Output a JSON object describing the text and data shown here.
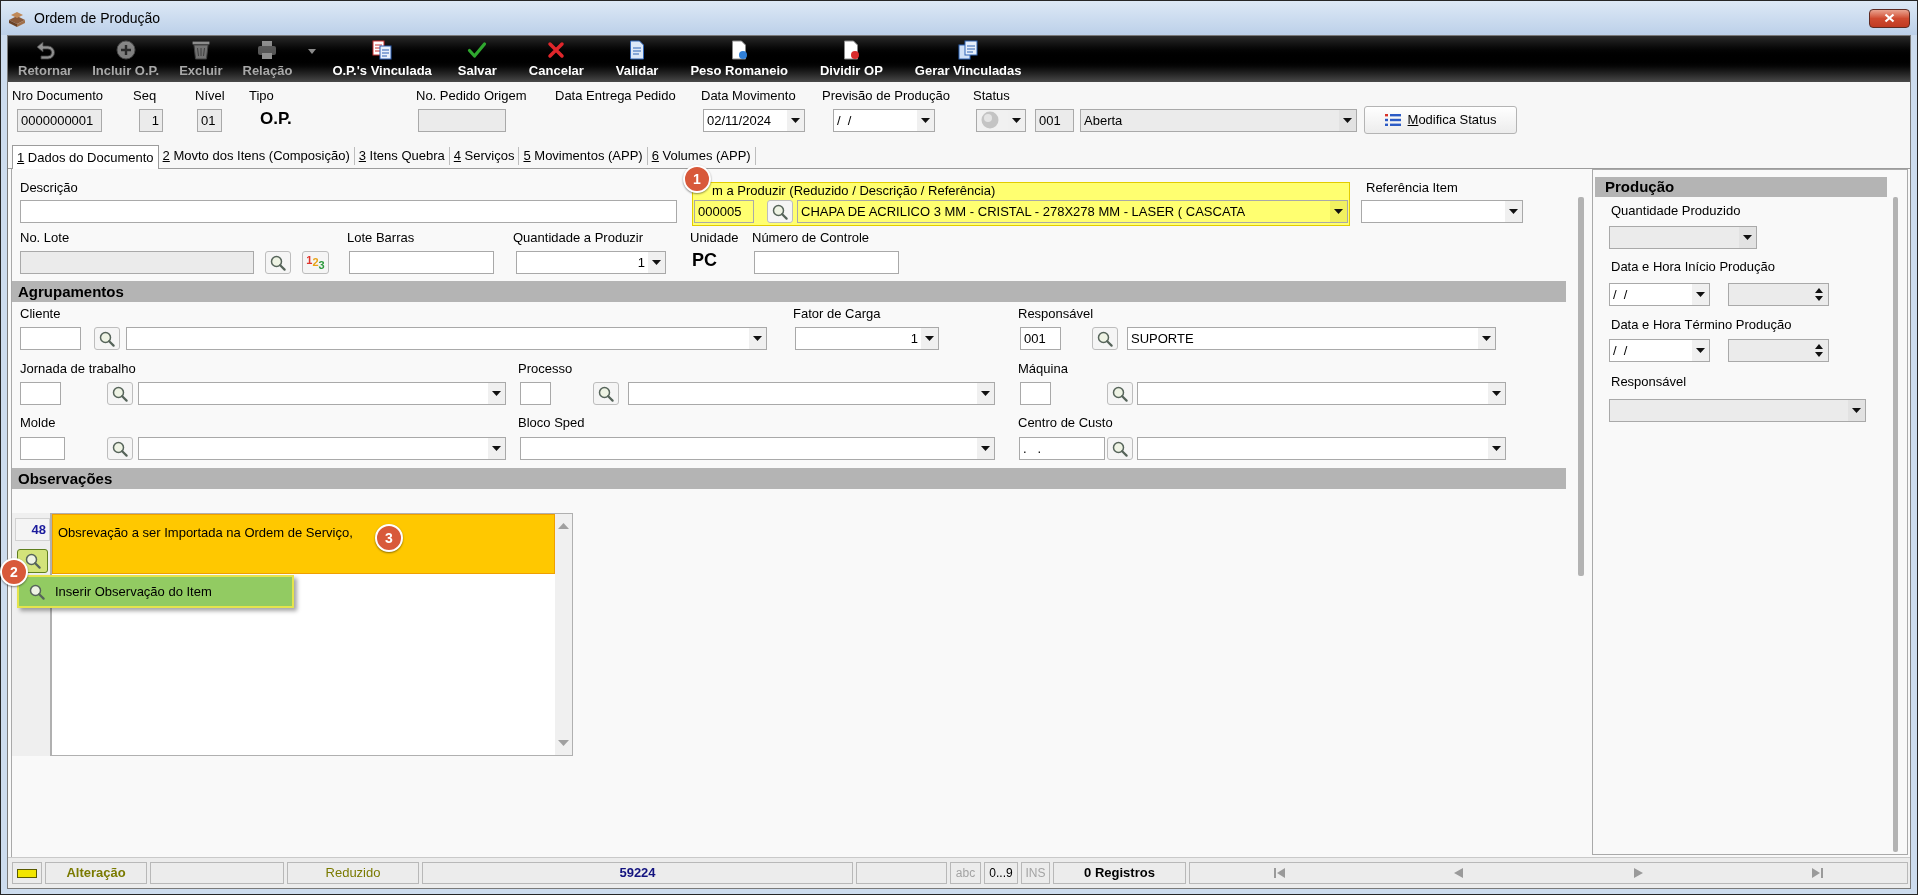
{
  "window": {
    "title": "Ordem de Produção"
  },
  "toolbar": [
    {
      "label": "Retornar",
      "disabled": true
    },
    {
      "label": "Incluir O.P.",
      "disabled": true
    },
    {
      "label": "Excluir",
      "disabled": true
    },
    {
      "label": "Relação",
      "disabled": true,
      "dropdown": true
    },
    {
      "label": "O.P.'s Vinculada",
      "disabled": false
    },
    {
      "label": "Salvar",
      "disabled": false
    },
    {
      "label": "Cancelar",
      "disabled": false
    },
    {
      "label": "Validar",
      "disabled": false
    },
    {
      "label": "Peso Romaneio",
      "disabled": false
    },
    {
      "label": "Dividir OP",
      "disabled": false
    },
    {
      "label": "Gerar Vinculadas",
      "disabled": false
    }
  ],
  "header": {
    "document_number": {
      "label": "Nro Documento",
      "value": "0000000001",
      "disabled": true
    },
    "seq": {
      "label": "Seq",
      "value": "1",
      "disabled": true
    },
    "nivel": {
      "label": "Nível",
      "value": "01",
      "disabled": true
    },
    "type": {
      "label": "Tipo",
      "value": "O.P."
    },
    "origin_order": {
      "label": "No. Pedido Origem",
      "disabled": true
    },
    "delivery_date": {
      "label": "Data Entrega Pedido"
    },
    "movement_date": {
      "label": "Data Movimento",
      "value": "02/11/2024"
    },
    "production_forecast": {
      "label": "Previsão de Produção",
      "value": "/  /"
    },
    "status": {
      "label": "Status",
      "code": "001",
      "value": "Aberta",
      "disabled": true
    },
    "modify_status_button": {
      "label": "Modifica Status"
    }
  },
  "tabs": [
    {
      "label": "1 Dados do Documento",
      "selected": true
    },
    {
      "label": "2 Movto dos Itens (Composição)",
      "selected": false
    },
    {
      "label": "3 Itens Quebra",
      "selected": false
    },
    {
      "label": "4 Serviços",
      "selected": false
    },
    {
      "label": "5 Movimentos (APP)",
      "selected": false
    },
    {
      "label": "6 Volumes (APP)",
      "selected": false
    }
  ],
  "document": {
    "description": {
      "label": "Descrição"
    },
    "item": {
      "label": "m a Produzir (Reduzido / Descrição / Referência)",
      "code": "000005",
      "value": "CHAPA DE ACRILICO 3 MM - CRISTAL - 278X278 MM - LASER ( CASCATA",
      "highlighted": true,
      "callout": "1"
    },
    "item_reference": {
      "label": "Referência Item"
    },
    "lot": {
      "label": "No. Lote",
      "disabled": true,
      "sequence_button": "123"
    },
    "lot_barcode": {
      "label": "Lote Barras"
    },
    "quantity": {
      "label": "Quantidade a Produzir",
      "value": "1"
    },
    "unit": {
      "label": "Unidade",
      "value": "PC"
    },
    "control_number": {
      "label": "Número de Controle"
    }
  },
  "groupings": {
    "title": "Agrupamentos",
    "rows": [
      [
        {
          "label": "Cliente",
          "kind": "lookup"
        },
        {
          "label": "Fator de Carga",
          "kind": "combo",
          "value": "1"
        },
        {
          "label": "Responsável",
          "kind": "lookup",
          "code": "001",
          "value": "SUPORTE"
        }
      ],
      [
        {
          "label": "Jornada de trabalho",
          "kind": "lookup"
        },
        {
          "label": "Processo",
          "kind": "lookup"
        },
        {
          "label": "Máquina",
          "kind": "lookup"
        }
      ],
      [
        {
          "label": "Molde",
          "kind": "lookup"
        },
        {
          "label": "Bloco Sped",
          "kind": "combo"
        },
        {
          "label": "Centro de Custo",
          "kind": "lookup",
          "code": ".   ."
        }
      ]
    ]
  },
  "observations": {
    "title": "Observações",
    "count": "48",
    "lines": [
      {
        "text": "Obsrevação a ser Importada na Ordem de Serviço,",
        "highlighted": true,
        "callout": "3"
      }
    ],
    "search_button": {
      "highlighted": true,
      "callout": "2"
    },
    "context_menu": [
      {
        "label": "Inserir Observação do Item",
        "selected": true
      }
    ]
  },
  "production": {
    "title": "Produção",
    "fields": [
      {
        "label": "Quantidade Produzido",
        "kind": "combo",
        "disabled": true
      },
      {
        "label": "Data e Hora Início Produção",
        "kind": "datetime",
        "date": "/  /"
      },
      {
        "label": "Data e Hora Término Produção",
        "kind": "datetime",
        "date": "/  /"
      },
      {
        "label": "Responsável",
        "kind": "combo",
        "disabled": true
      }
    ]
  },
  "status_bar": {
    "mode": "Alteração",
    "search_key": "Reduzido",
    "value": "59224",
    "indicators": [
      {
        "label": "abc",
        "on": false
      },
      {
        "label": "0...9",
        "on": true
      },
      {
        "label": "INS",
        "on": false
      }
    ],
    "records": "0 Registros"
  }
}
